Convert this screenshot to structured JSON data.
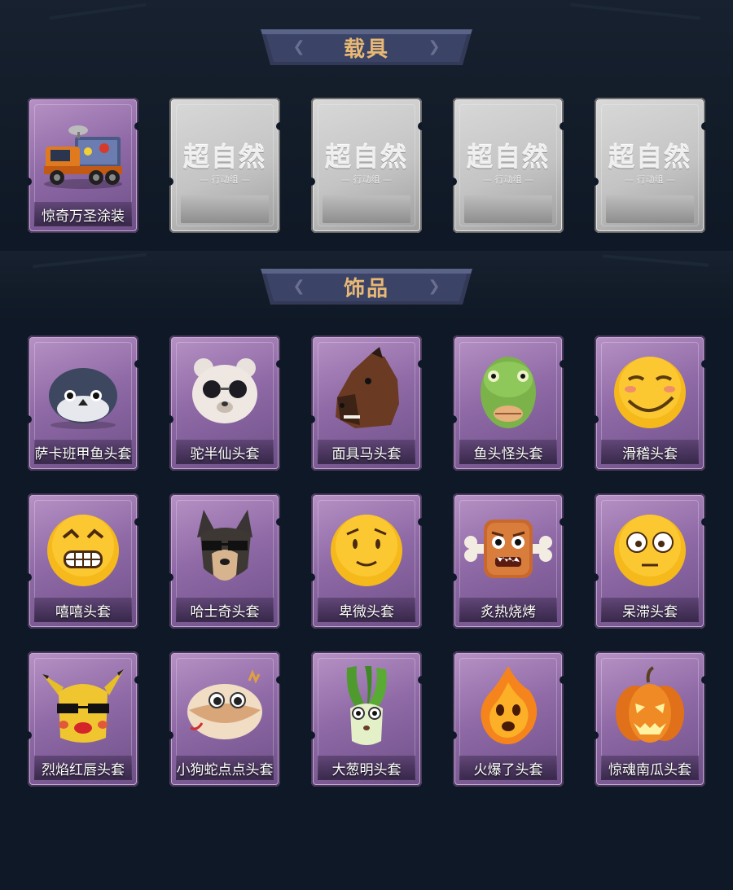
{
  "sections": {
    "vehicles": {
      "title": "载具",
      "items": [
        {
          "label": "惊奇万圣涂装",
          "icon": "halloween-truck-icon",
          "filled": true
        },
        {
          "brand": "超自然",
          "sub": "— 行动组 —",
          "icon": "placeholder-logo-icon",
          "filled": false
        },
        {
          "brand": "超自然",
          "sub": "— 行动组 —",
          "icon": "placeholder-logo-icon",
          "filled": false
        },
        {
          "brand": "超自然",
          "sub": "— 行动组 —",
          "icon": "placeholder-logo-icon",
          "filled": false
        },
        {
          "brand": "超自然",
          "sub": "— 行动组 —",
          "icon": "placeholder-logo-icon",
          "filled": false
        }
      ]
    },
    "accessories": {
      "title": "饰品",
      "items": [
        {
          "label": "萨卡班甲鱼头套",
          "icon": "fish-head-icon"
        },
        {
          "label": "驼半仙头套",
          "icon": "bear-sunglasses-icon"
        },
        {
          "label": "面具马头套",
          "icon": "horse-mask-icon"
        },
        {
          "label": "鱼头怪头套",
          "icon": "green-fish-icon"
        },
        {
          "label": "滑稽头套",
          "icon": "smirk-emoji-icon"
        },
        {
          "label": "嘻嘻头套",
          "icon": "grin-emoji-icon"
        },
        {
          "label": "哈士奇头套",
          "icon": "husky-icon"
        },
        {
          "label": "卑微头套",
          "icon": "humble-emoji-icon"
        },
        {
          "label": "炙热烧烤",
          "icon": "meat-monster-icon"
        },
        {
          "label": "呆滞头套",
          "icon": "dazed-emoji-icon"
        },
        {
          "label": "烈焰红唇头套",
          "icon": "pikachu-lips-icon"
        },
        {
          "label": "小狗蛇点点头套",
          "icon": "snake-head-icon"
        },
        {
          "label": "大葱明头套",
          "icon": "scallion-icon"
        },
        {
          "label": "火爆了头套",
          "icon": "fireball-icon"
        },
        {
          "label": "惊魂南瓜头套",
          "icon": "pumpkin-icon"
        }
      ]
    }
  },
  "colors": {
    "background": "#0f1826",
    "title": "#e8b874",
    "card_purple": "#9a76b0",
    "card_empty": "#c8c8c8"
  }
}
